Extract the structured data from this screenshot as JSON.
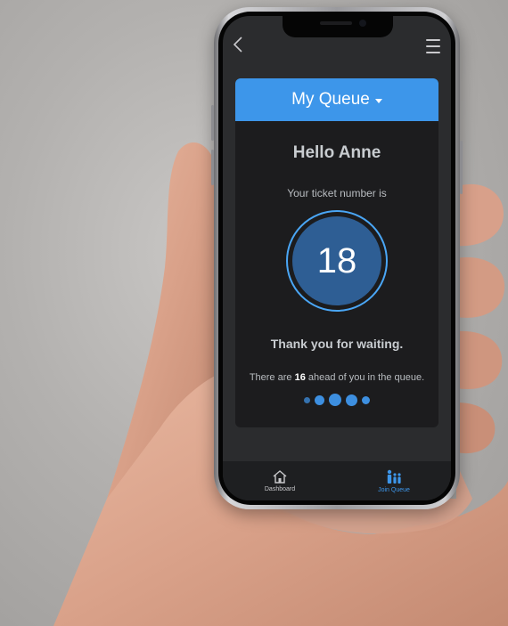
{
  "app": {
    "header_title": "My Queue",
    "greeting": "Hello Anne",
    "ticket_label": "Your ticket number is",
    "ticket_number": "18",
    "thanks_message": "Thank you for waiting.",
    "queue_text_before": "There are",
    "queue_ahead_count": "16",
    "queue_text_after": "ahead of you in the queue.",
    "progress_dots": 5
  },
  "tabbar": {
    "items": [
      {
        "label": "Dashboard",
        "icon": "home-icon",
        "active": false
      },
      {
        "label": "Join Queue",
        "icon": "people-queue-icon",
        "active": true
      }
    ]
  },
  "colors": {
    "accent": "#3d96ea",
    "ticket_fill": "#2e5e94",
    "card_bg": "#1c1c1e",
    "screen_bg": "#2b2c2e"
  }
}
